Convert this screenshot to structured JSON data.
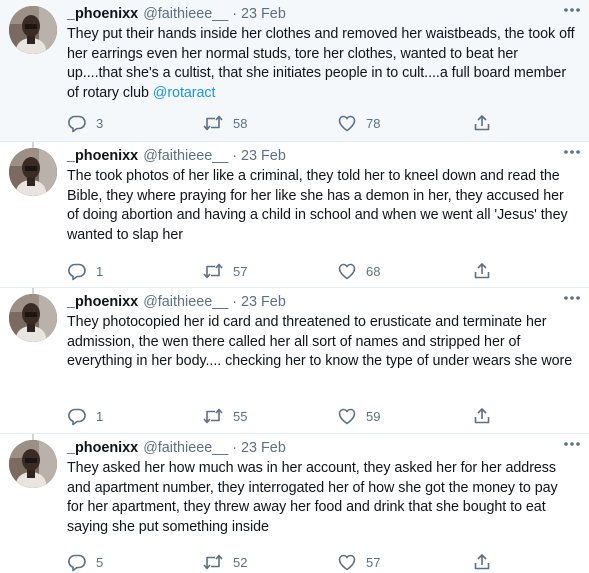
{
  "tweets": [
    {
      "name": "_phoenixx",
      "handle": "@faithieee__",
      "separator": "·",
      "date": "23 Feb",
      "text": "They put their hands inside her clothes and removed her waistbeads, the took off her earrings even her normal studs, tore her clothes, wanted to beat her up....that she's a cultist, that she initiates people in to cult....a full board member of rotary club ",
      "mention": "@rotaract",
      "replies": "3",
      "retweets": "58",
      "likes": "78"
    },
    {
      "name": "_phoenixx",
      "handle": "@faithieee__",
      "separator": "·",
      "date": "23 Feb",
      "text": "The took photos of her like a criminal, they told her to kneel down and read the Bible, they where praying for her like she has a demon in her, they accused her of doing abortion and having a child in school and when we went all 'Jesus'  they wanted to slap her",
      "replies": "1",
      "retweets": "57",
      "likes": "68"
    },
    {
      "name": "_phoenixx",
      "handle": "@faithieee__",
      "separator": "·",
      "date": "23 Feb",
      "text": "They photocopied her id card and threatened to erusticate and terminate her admission, the wen there called her all sort of names and stripped her of everything in her body.... checking her  to know the type of under wears she wore",
      "replies": "1",
      "retweets": "55",
      "likes": "59"
    },
    {
      "name": "_phoenixx",
      "handle": "@faithieee__",
      "separator": "·",
      "date": "23 Feb",
      "text": "They asked her how much was in her account, they asked her for her address and apartment number, they interrogated her of how she got the money to pay for her apartment, they threw away her food and drink that she bought to eat saying she put something inside",
      "replies": "5",
      "retweets": "52",
      "likes": "57"
    }
  ],
  "colors": {
    "text": "#0f1419",
    "muted": "#5b7083",
    "link": "#1b95e0",
    "highlight_bg": "#f5f8fa",
    "divider": "#e6ecf0"
  },
  "icons": [
    "more-icon",
    "reply-icon",
    "retweet-icon",
    "like-icon",
    "share-icon"
  ]
}
